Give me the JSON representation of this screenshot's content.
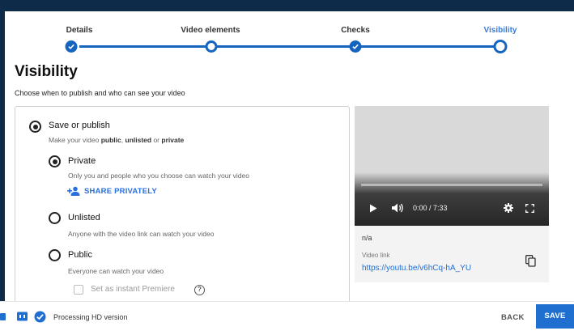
{
  "stepper": {
    "steps": [
      {
        "label": "Details",
        "state": "done"
      },
      {
        "label": "Video elements",
        "state": "open"
      },
      {
        "label": "Checks",
        "state": "done"
      },
      {
        "label": "Visibility",
        "state": "current"
      }
    ]
  },
  "page": {
    "title": "Visibility",
    "subtitle": "Choose when to publish and who can see your video"
  },
  "options": {
    "save_publish": {
      "label": "Save or publish",
      "desc_prefix": "Make your video ",
      "desc_public": "public",
      "desc_sep": ", ",
      "desc_unlisted": "unlisted",
      "desc_or": " or ",
      "desc_private": "private"
    },
    "private": {
      "label": "Private",
      "desc": "Only you and people who you choose can watch your video",
      "share_label": "SHARE PRIVATELY"
    },
    "unlisted": {
      "label": "Unlisted",
      "desc": "Anyone with the video link can watch your video"
    },
    "public": {
      "label": "Public",
      "desc": "Everyone can watch your video",
      "premiere_label": "Set as instant Premiere",
      "help": "?"
    }
  },
  "preview": {
    "time": "0:00 / 7:33",
    "title": "n/a",
    "link_label": "Video link",
    "link": "https://youtu.be/v6hCq-hA_YU"
  },
  "footer": {
    "status": "Processing HD version",
    "back_label": "BACK",
    "save_label": "SAVE"
  },
  "colors": {
    "accent": "#1f6fd1",
    "step": "#1565c0",
    "frame": "#0f2b4a"
  }
}
